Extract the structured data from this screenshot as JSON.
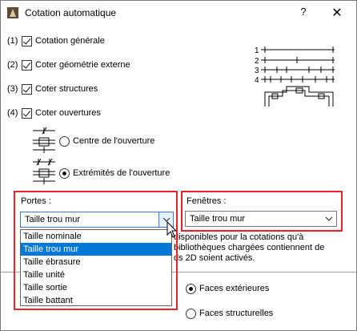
{
  "window": {
    "title": "Cotation automatique",
    "help": "?",
    "close": "✕"
  },
  "options": [
    {
      "index": "(1)",
      "label": "Cotation générale",
      "checked": true
    },
    {
      "index": "(2)",
      "label": "Coter géométrie externe",
      "checked": true
    },
    {
      "index": "(3)",
      "label": "Coter structures",
      "checked": true
    },
    {
      "index": "(4)",
      "label": "Coter ouvertures",
      "checked": true
    }
  ],
  "opening_mode": {
    "center_label": "Centre de l'ouverture",
    "ends_label": "Extrémités de l'ouverture",
    "selected": "ends"
  },
  "portes": {
    "label": "Portes :",
    "value": "Taille trou mur",
    "options": [
      "Taille nominale",
      "Taille trou mur",
      "Taille ébrasure",
      "Taille unité",
      "Taille sortie",
      "Taille battant"
    ],
    "selected_index": 1
  },
  "fenetres": {
    "label": "Fenêtres :",
    "value": "Taille trou mur"
  },
  "info_text": "disponibles pour la cotations qu'à bibliothèques chargées contiennent de ds 2D soient activés.",
  "faces": {
    "exterior_label": "Faces extérieures",
    "structural_label": "Faces structurelles",
    "selected": "exterior"
  },
  "legend_numbers": [
    "1",
    "2",
    "3",
    "4"
  ],
  "colors": {
    "highlight_box": "#e8232a",
    "selection": "#0078d7"
  }
}
